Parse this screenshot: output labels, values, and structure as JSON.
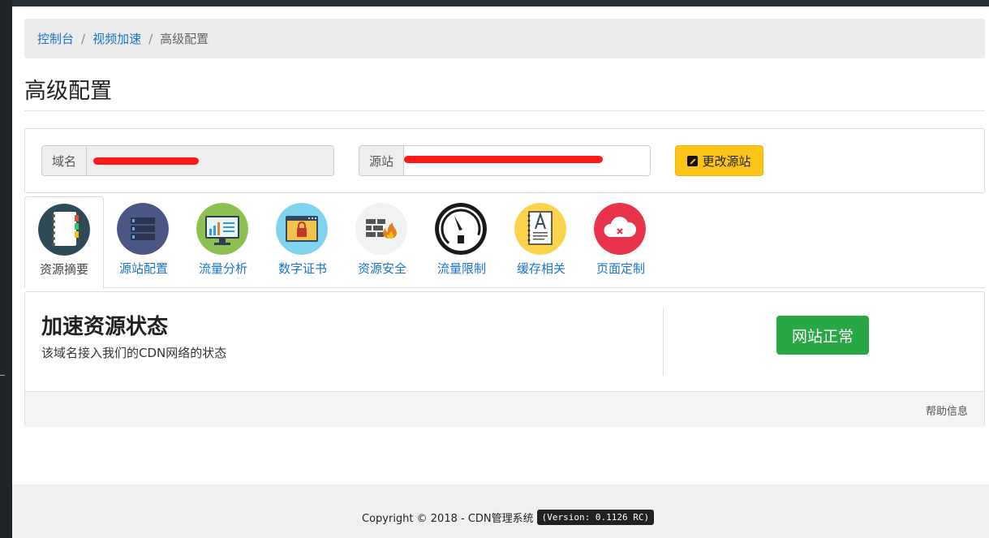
{
  "breadcrumb": {
    "items": [
      "控制台",
      "视频加速"
    ],
    "current": "高级配置"
  },
  "page": {
    "title": "高级配置"
  },
  "domain_panel": {
    "domain_label": "域名",
    "domain_value": "",
    "origin_label": "源站",
    "origin_value": "",
    "change_origin_button": "更改源站"
  },
  "tabs": [
    {
      "label": "资源摘要",
      "icon": "notebook-icon",
      "active": true
    },
    {
      "label": "源站配置",
      "icon": "server-icon",
      "active": false
    },
    {
      "label": "流量分析",
      "icon": "monitor-chart-icon",
      "active": false
    },
    {
      "label": "数字证书",
      "icon": "browser-lock-icon",
      "active": false
    },
    {
      "label": "资源安全",
      "icon": "firewall-icon",
      "active": false
    },
    {
      "label": "流量限制",
      "icon": "speedometer-icon",
      "active": false
    },
    {
      "label": "缓存相关",
      "icon": "document-icon",
      "active": false
    },
    {
      "label": "页面定制",
      "icon": "cloud-error-icon",
      "active": false
    }
  ],
  "status": {
    "title": "加速资源状态",
    "subtitle": "该域名接入我们的CDN网络的状态",
    "state_button": "网站正常",
    "help": "帮助信息"
  },
  "footer": {
    "copyright": "Copyright © 2018 - CDN管理系统",
    "version": "(Version: 0.1126 RC)"
  },
  "colors": {
    "link": "#1a73c9",
    "warning": "#fcc419",
    "success": "#28a745"
  }
}
